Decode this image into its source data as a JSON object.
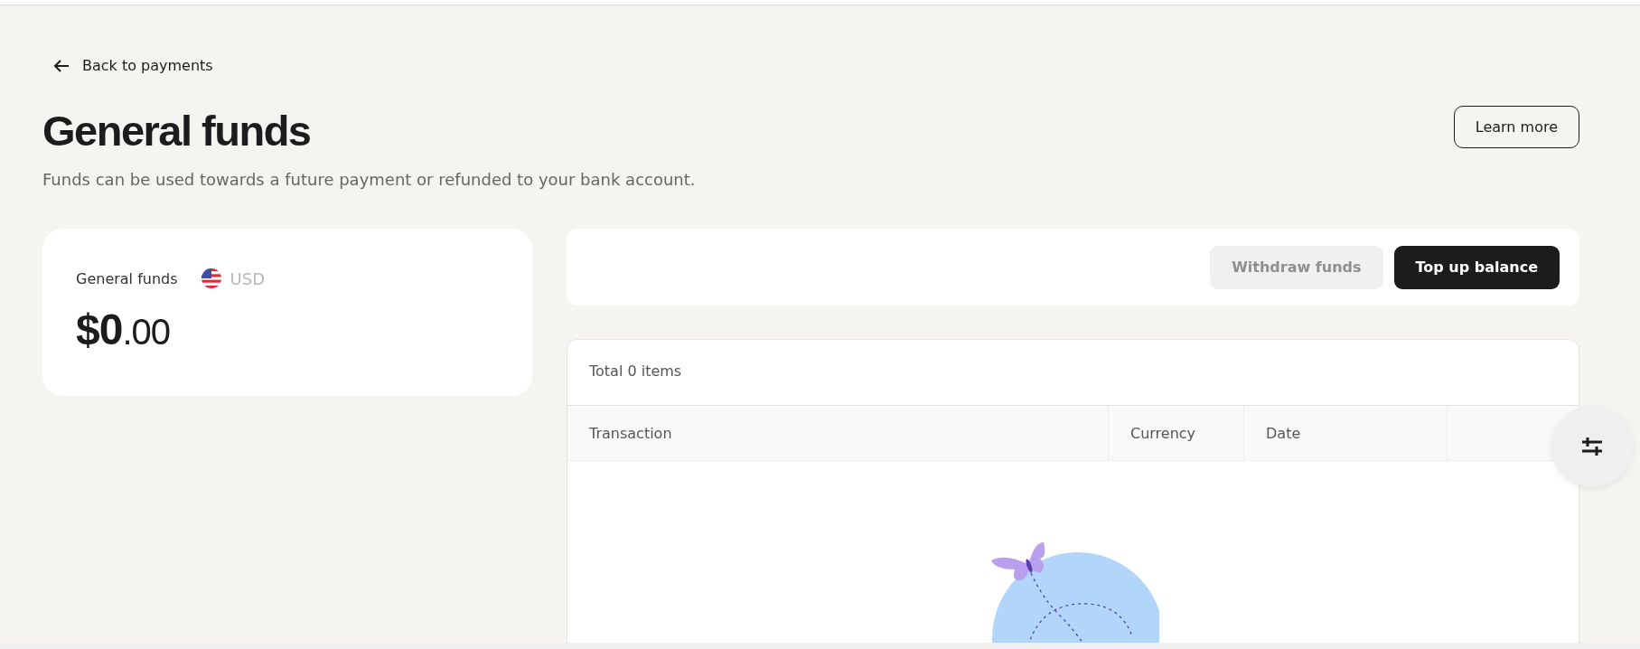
{
  "back_link": {
    "label": "Back to payments"
  },
  "header": {
    "title": "General funds",
    "subtitle": "Funds can be used towards a future payment or refunded to your bank account.",
    "learn_more": "Learn more"
  },
  "balance_card": {
    "label": "General funds",
    "currency": "USD",
    "amount_whole": "$0",
    "amount_fraction": ".00"
  },
  "actions": [
    {
      "label": "Withdraw funds",
      "kind": "secondary",
      "disabled": true
    },
    {
      "label": "Top up balance",
      "kind": "primary",
      "disabled": false
    }
  ],
  "table": {
    "total": "Total 0 items",
    "columns": [
      "Transaction",
      "Currency",
      "Date",
      ""
    ]
  }
}
